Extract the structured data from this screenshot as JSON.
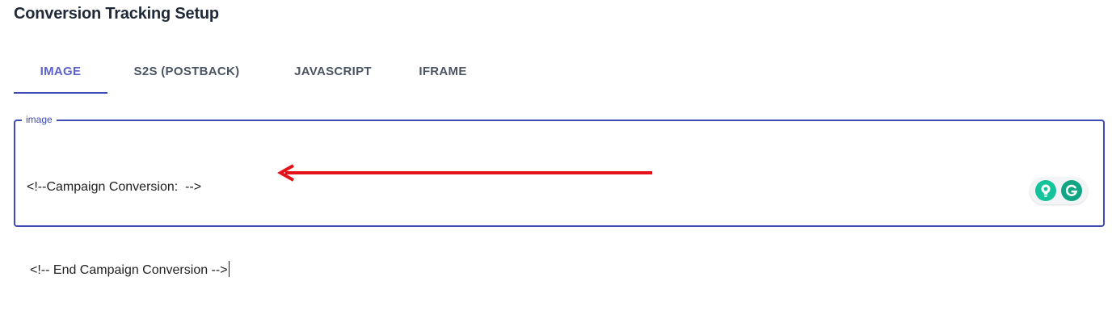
{
  "page": {
    "title": "Conversion Tracking Setup"
  },
  "tabs": [
    {
      "label": "IMAGE",
      "active": true
    },
    {
      "label": "S2S (POSTBACK)",
      "active": false
    },
    {
      "label": "JAVASCRIPT",
      "active": false
    },
    {
      "label": "IFRAME",
      "active": false
    }
  ],
  "field": {
    "legend": "image",
    "line1": "<!--Campaign Conversion:  -->",
    "line2": "<!-- End Campaign Conversion -->"
  },
  "annotation": {
    "arrow_color": "#e3121b",
    "icon": "left-arrow-icon"
  },
  "grammarly": {
    "icons": [
      "lightbulb-icon",
      "grammarly-g-icon"
    ],
    "color": "#15c39a"
  },
  "colors": {
    "accent": "#3f4bb5",
    "active_tab": "#5b62cf"
  }
}
